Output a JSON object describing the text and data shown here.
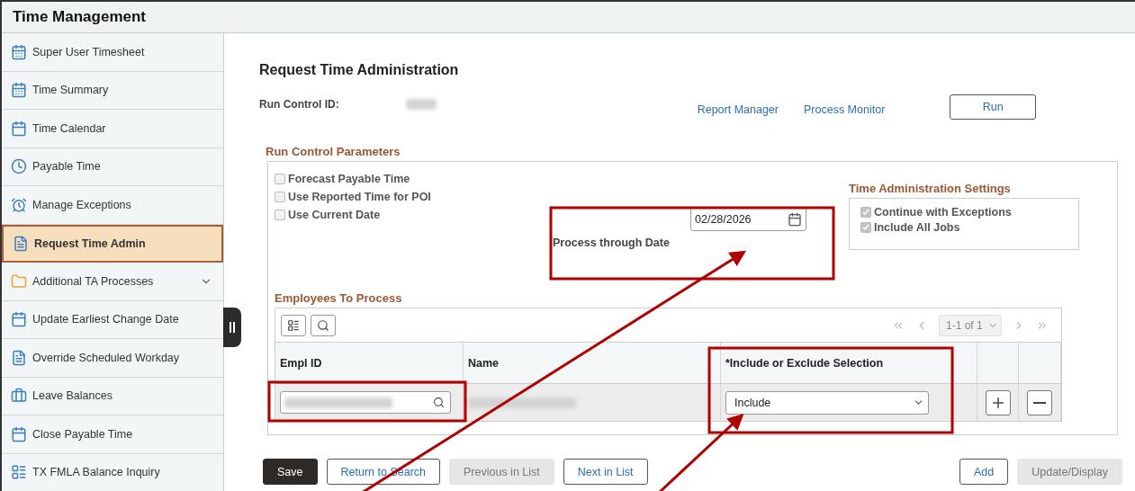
{
  "header": {
    "title": "Time Management"
  },
  "sidebar": {
    "items": [
      {
        "label": "Super User Timesheet",
        "selected": false,
        "expandable": false
      },
      {
        "label": "Time Summary",
        "selected": false,
        "expandable": false
      },
      {
        "label": "Time Calendar",
        "selected": false,
        "expandable": false
      },
      {
        "label": "Payable Time",
        "selected": false,
        "expandable": false
      },
      {
        "label": "Manage Exceptions",
        "selected": false,
        "expandable": false
      },
      {
        "label": "Request Time Admin",
        "selected": true,
        "expandable": false
      },
      {
        "label": "Additional TA Processes",
        "selected": false,
        "expandable": true
      },
      {
        "label": "Update Earliest Change Date",
        "selected": false,
        "expandable": false
      },
      {
        "label": "Override Scheduled Workday",
        "selected": false,
        "expandable": false
      },
      {
        "label": "Leave Balances",
        "selected": false,
        "expandable": false
      },
      {
        "label": "Close Payable Time",
        "selected": false,
        "expandable": false
      },
      {
        "label": "TX FMLA Balance Inquiry",
        "selected": false,
        "expandable": false
      }
    ]
  },
  "page": {
    "title": "Request Time Administration",
    "run_control_label": "Run Control ID:",
    "links": [
      "Report Manager",
      "Process Monitor"
    ],
    "run_button": "Run"
  },
  "parameters": {
    "title": "Run Control Parameters",
    "options": [
      {
        "label": "Forecast Payable Time",
        "checked": false,
        "disabled": true
      },
      {
        "label": "Use Reported Time for POI",
        "checked": false,
        "disabled": true
      },
      {
        "label": "Use Current Date",
        "checked": false,
        "disabled": true
      }
    ],
    "date_label": "Process through Date",
    "date_value": "02/28/2026",
    "settings": {
      "title": "Time Administration Settings",
      "options": [
        {
          "label": "Continue with Exceptions",
          "checked": true,
          "disabled": true
        },
        {
          "label": "Include All Jobs",
          "checked": true,
          "disabled": true
        }
      ]
    }
  },
  "employees": {
    "title": "Employees To Process",
    "pager": "1-1 of 1",
    "columns": [
      "Empl ID",
      "Name",
      "*Include or Exclude Selection"
    ],
    "rows": [
      {
        "selection": "Include"
      }
    ]
  },
  "buttons": [
    {
      "label": "Save",
      "kind": "primary",
      "disabled": false
    },
    {
      "label": "Return to Search",
      "kind": "default",
      "disabled": false
    },
    {
      "label": "Previous in List",
      "kind": "default",
      "disabled": true
    },
    {
      "label": "Next in List",
      "kind": "default",
      "disabled": false
    }
  ],
  "right_buttons": [
    {
      "label": "Add",
      "kind": "default",
      "disabled": false
    },
    {
      "label": "Update/Display",
      "kind": "default",
      "disabled": true
    }
  ]
}
